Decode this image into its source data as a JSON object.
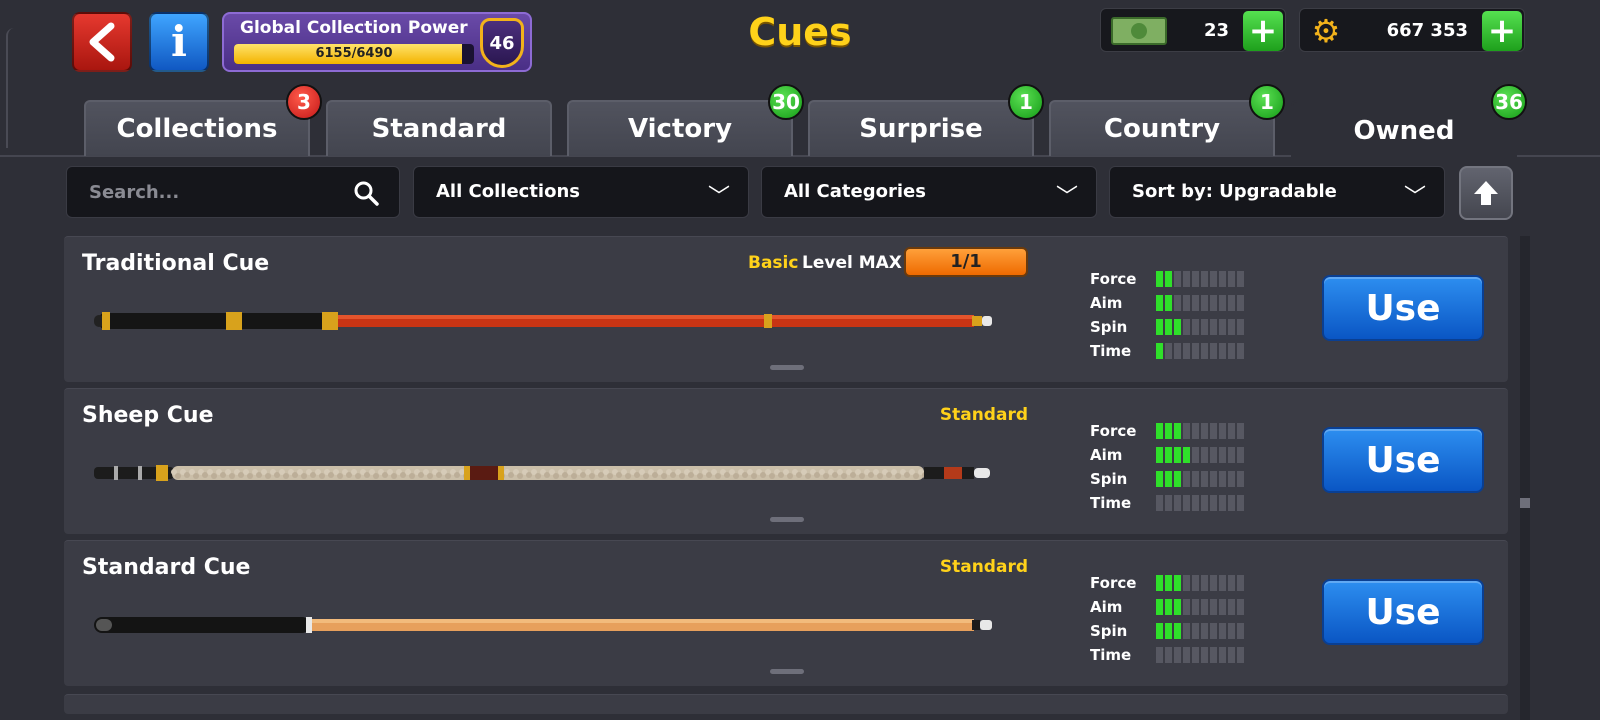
{
  "header": {
    "back_icon": "chevron-left-icon",
    "info_icon": "info-icon",
    "info_glyph": "i",
    "title": "Cues",
    "global_power": {
      "label": "Global Collection Power",
      "progress_text": "6155/6490",
      "current": 6155,
      "max": 6490,
      "level": "46"
    },
    "currencies": {
      "cash": {
        "value": "23",
        "icon": "cash-icon"
      },
      "coins": {
        "value": "667 353",
        "icon": "gear-coin-icon"
      },
      "plus_label": "+"
    }
  },
  "tabs": [
    {
      "label": "Collections",
      "badge": "3",
      "badge_color": "#d42020",
      "active": false
    },
    {
      "label": "Standard",
      "badge": null,
      "active": false
    },
    {
      "label": "Victory",
      "badge": "30",
      "badge_color": "#1fae1c",
      "active": false
    },
    {
      "label": "Surprise",
      "badge": "1",
      "badge_color": "#1fae1c",
      "active": false
    },
    {
      "label": "Country",
      "badge": "1",
      "badge_color": "#1fae1c",
      "active": false
    },
    {
      "label": "Owned",
      "badge": "36",
      "badge_color": "#1fae1c",
      "active": true
    }
  ],
  "filters": {
    "search_placeholder": "Search...",
    "collection": "All Collections",
    "category": "All Categories",
    "sort": "Sort by: Upgradable"
  },
  "stat_labels": {
    "force": "Force",
    "aim": "Aim",
    "spin": "Spin",
    "time": "Time"
  },
  "stat_max": 10,
  "cues": [
    {
      "name": "Traditional Cue",
      "tier": "Basic",
      "tier_color": "#ffd21a",
      "level_label": "Level MAX",
      "level_progress": "1/1",
      "stats": {
        "force": 2,
        "aim": 2,
        "spin": 3,
        "time": 1
      },
      "action": "Use",
      "style": "red"
    },
    {
      "name": "Sheep Cue",
      "tier": "Standard",
      "tier_color": "#ffd21a",
      "stats": {
        "force": 3,
        "aim": 4,
        "spin": 3,
        "time": 0
      },
      "action": "Use",
      "style": "wool"
    },
    {
      "name": "Standard Cue",
      "tier": "Standard",
      "tier_color": "#ffd21a",
      "stats": {
        "force": 3,
        "aim": 3,
        "spin": 3,
        "time": 0
      },
      "action": "Use",
      "style": "wood"
    }
  ],
  "colors": {
    "accent_yellow": "#ffd21a",
    "use_button": "#1a6fe0",
    "stat_on": "#2fe02a",
    "stat_off": "#575862"
  }
}
